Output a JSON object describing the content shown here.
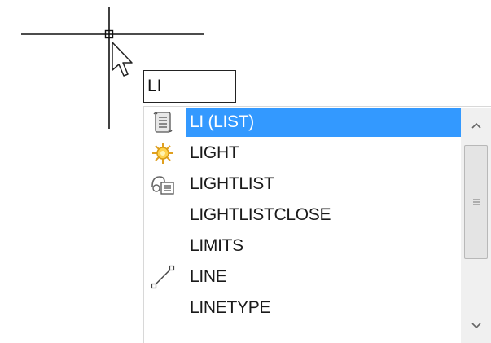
{
  "command_input": {
    "value": "LI"
  },
  "autocomplete": {
    "items": [
      {
        "label": "LI (LIST)",
        "icon": "list-scroll-icon",
        "selected": true
      },
      {
        "label": "LIGHT",
        "icon": "light-bulb-icon",
        "selected": false
      },
      {
        "label": "LIGHTLIST",
        "icon": "light-list-icon",
        "selected": false
      },
      {
        "label": "LIGHTLISTCLOSE",
        "icon": "",
        "selected": false
      },
      {
        "label": "LIMITS",
        "icon": "",
        "selected": false
      },
      {
        "label": "LINE",
        "icon": "line-icon",
        "selected": false
      },
      {
        "label": "LINETYPE",
        "icon": "",
        "selected": false
      }
    ]
  },
  "colors": {
    "selection": "#3399ff",
    "crosshair": "#111111"
  }
}
